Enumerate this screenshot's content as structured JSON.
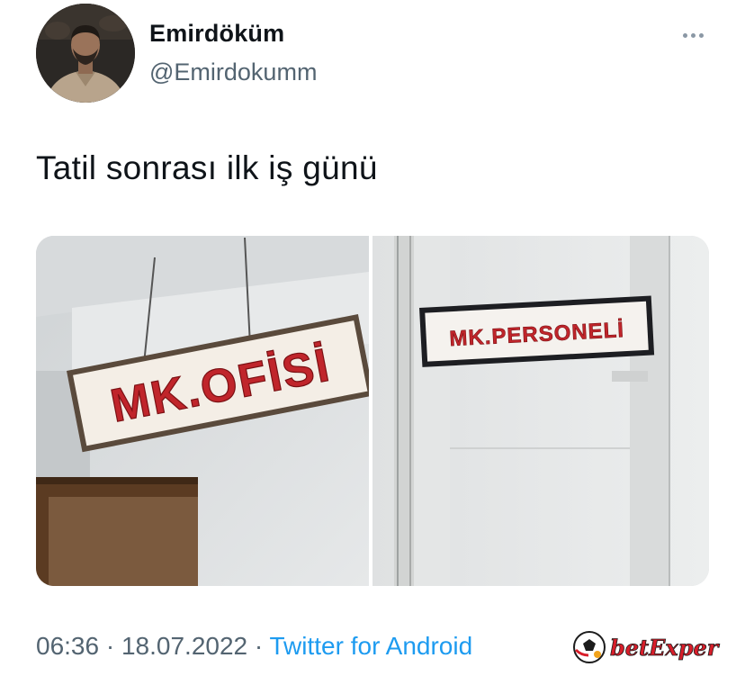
{
  "tweet": {
    "author": {
      "display_name": "Emirdöküm",
      "handle": "@Emirdokumm"
    },
    "text": "Tatil sonrası ilk iş günü",
    "media": {
      "left_sign": "MK.OFİSİ",
      "right_sign": "MK.PERSONELİ"
    },
    "time": "06:36",
    "date": "18.07.2022",
    "separator": "·",
    "source": "Twitter for Android"
  },
  "watermark": {
    "brand": "betExper"
  },
  "icons": {
    "more": "more-dots-icon",
    "watermark_logo": "ball-logo-icon"
  },
  "colors": {
    "text_primary": "#0f1419",
    "text_secondary": "#536471",
    "link": "#1d9bf0",
    "sign_red": "#c0252b",
    "watermark_red": "#d81e2a"
  }
}
